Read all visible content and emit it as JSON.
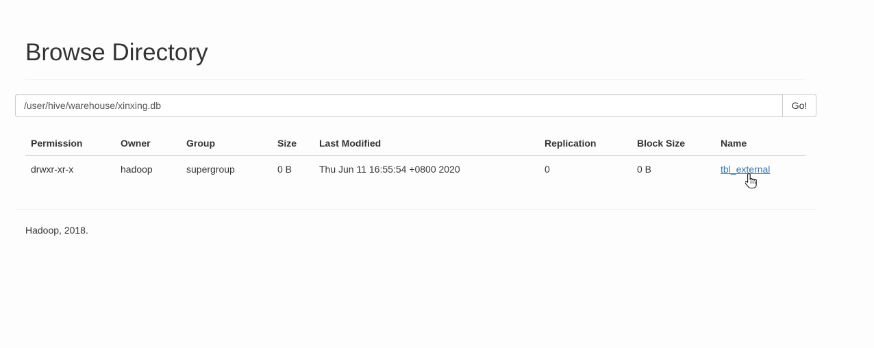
{
  "header": {
    "title": "Browse Directory"
  },
  "path_form": {
    "value": "/user/hive/warehouse/xinxing.db",
    "go_label": "Go!"
  },
  "table": {
    "columns": [
      "Permission",
      "Owner",
      "Group",
      "Size",
      "Last Modified",
      "Replication",
      "Block Size",
      "Name"
    ],
    "rows": [
      {
        "permission": "drwxr-xr-x",
        "owner": "hadoop",
        "group": "supergroup",
        "size": "0 B",
        "last_modified": "Thu Jun 11 16:55:54 +0800 2020",
        "replication": "0",
        "block_size": "0 B",
        "name": "tbl_external"
      }
    ]
  },
  "footer": {
    "text": "Hadoop, 2018."
  },
  "colors": {
    "link": "#337ab7",
    "text": "#333333",
    "border": "#dddddd"
  },
  "icons": {
    "cursor": "hand-pointer-icon"
  }
}
